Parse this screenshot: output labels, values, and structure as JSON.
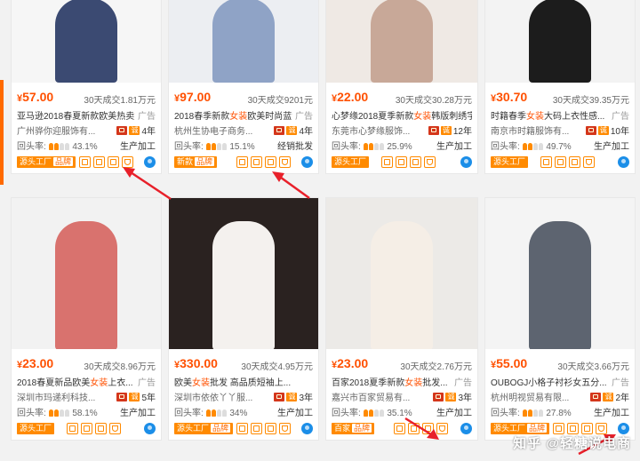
{
  "products": [
    {
      "price_sym": "¥",
      "price": "57.00",
      "sales": "30天成交1.81万元",
      "title_pre": "亚马逊2018春夏新款欧美热卖",
      "title_hl": "女装",
      "title_post": "...",
      "ad": "广告",
      "shop": "广州骅你迎服饰有...",
      "years": "4年",
      "rate_label": "回头率:",
      "rate": "43.1%",
      "mode": "生产加工",
      "tag": "源头工厂",
      "tag_sub": "品牌",
      "img_bg": "#f6f6f6",
      "img_fg": "#3b4a72"
    },
    {
      "price_sym": "¥",
      "price": "97.00",
      "sales": "30天成交9201元",
      "title_pre": "2018春季新款",
      "title_hl": "女装",
      "title_post": "欧美时尚蓝色条...",
      "ad": "广告",
      "shop": "杭州生协电子商务...",
      "years": "4年",
      "rate_label": "回头率:",
      "rate": "15.1%",
      "mode": "经销批发",
      "tag": "新款",
      "tag_sub": "品牌",
      "img_bg": "#eceef2",
      "img_fg": "#8fa3c6"
    },
    {
      "price_sym": "¥",
      "price": "22.00",
      "sales": "30天成交30.28万元",
      "title_pre": "心梦缘2018夏季新款",
      "title_hl": "女装",
      "title_post": "韩版刺绣字母圆领...",
      "ad": "",
      "shop": "东莞市心梦缘服饰...",
      "years": "12年",
      "rate_label": "回头率:",
      "rate": "25.9%",
      "mode": "生产加工",
      "tag": "源头工厂",
      "tag_sub": "",
      "img_bg": "#efe9e4",
      "img_fg": "#c8a898"
    },
    {
      "price_sym": "¥",
      "price": "30.70",
      "sales": "30天成交39.35万元",
      "title_pre": "时籍春季",
      "title_hl": "女装",
      "title_post": "大码上衣性感...",
      "ad": "广告",
      "shop": "南京市时籍服饰有...",
      "years": "10年",
      "rate_label": "回头率:",
      "rate": "49.7%",
      "mode": "生产加工",
      "tag": "源头工厂",
      "tag_sub": "",
      "img_bg": "#f3f3f3",
      "img_fg": "#1c1c1c"
    },
    {
      "price_sym": "¥",
      "price": "23.00",
      "sales": "30天成交8.96万元",
      "title_pre": "2018春夏新品欧美",
      "title_hl": "女装",
      "title_post": "上衣...",
      "ad": "广告",
      "shop": "深圳市玛递利科技...",
      "years": "5年",
      "rate_label": "回头率:",
      "rate": "58.1%",
      "mode": "生产加工",
      "tag": "源头工厂",
      "tag_sub": "",
      "img_bg": "#f2f2f2",
      "img_fg": "#d9726e"
    },
    {
      "price_sym": "¥",
      "price": "330.00",
      "sales": "30天成交4.95万元",
      "title_pre": "欧美",
      "title_hl": "女装",
      "title_post": "批发 高品质短袖上...",
      "ad": "",
      "shop": "深圳市依依丫丫服...",
      "years": "3年",
      "rate_label": "回头率:",
      "rate": "34%",
      "mode": "生产加工",
      "tag": "源头工厂",
      "tag_sub": "品牌",
      "img_bg": "#2a2220",
      "img_fg": "#f4f1ee"
    },
    {
      "price_sym": "¥",
      "price": "23.00",
      "sales": "30天成交2.76万元",
      "title_pre": "百家2018夏季新款",
      "title_hl": "女装",
      "title_post": "批发...",
      "ad": "广告",
      "shop": "嘉兴市百家贸易有...",
      "years": "3年",
      "rate_label": "回头率:",
      "rate": "35.1%",
      "mode": "生产加工",
      "tag": "百家",
      "tag_sub": "品牌",
      "img_bg": "#eceae7",
      "img_fg": "#f5eee6"
    },
    {
      "price_sym": "¥",
      "price": "55.00",
      "sales": "30天成交3.66万元",
      "title_pre": "OUBOGJ小格子衬衫女五分...",
      "title_hl": "",
      "title_post": "",
      "ad": "广告",
      "shop": "杭州明视贸易有限...",
      "years": "2年",
      "rate_label": "回头率:",
      "rate": "27.8%",
      "mode": "生产加工",
      "tag": "源头工厂",
      "tag_sub": "品牌",
      "img_bg": "#f4f4f4",
      "img_fg": "#5d6470"
    }
  ],
  "watermark": "知乎 @轻糖说电商",
  "colors": {
    "accent": "#ff5000",
    "tag": "#ff8a00",
    "arrow": "#e8202a",
    "wangwang": "#1b8ee8"
  }
}
